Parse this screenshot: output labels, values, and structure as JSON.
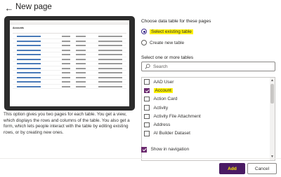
{
  "dialog": {
    "title": "New page",
    "back_icon": "arrow-left-icon"
  },
  "preview": {
    "screen_title": "Accounts",
    "row_count": 12
  },
  "description": "This option gives you two pages for each table. You get a view, which displays the rows and columns of the table. You also get a form, which lets people interact with the table by editing existing rows, or by creating new ones.",
  "data_source": {
    "label": "Choose data table for these pages",
    "options": [
      {
        "label": "Select existing table",
        "selected": true
      },
      {
        "label": "Create new table",
        "selected": false
      }
    ]
  },
  "tables": {
    "label": "Select one or more tables",
    "search_placeholder": "Search",
    "items": [
      {
        "label": "AAD User",
        "checked": false
      },
      {
        "label": "Account",
        "checked": true
      },
      {
        "label": "Action Card",
        "checked": false
      },
      {
        "label": "Activity",
        "checked": false
      },
      {
        "label": "Activity File Attachment",
        "checked": false
      },
      {
        "label": "Address",
        "checked": false
      },
      {
        "label": "AI Builder Dataset",
        "checked": false
      }
    ]
  },
  "show_navigation": {
    "label": "Show in navigation",
    "checked": true
  },
  "buttons": {
    "add": "Add",
    "cancel": "Cancel"
  },
  "colors": {
    "accent": "#4a1b63",
    "highlight": "#fff200",
    "checkbox_checked": "#6b2a6e"
  }
}
